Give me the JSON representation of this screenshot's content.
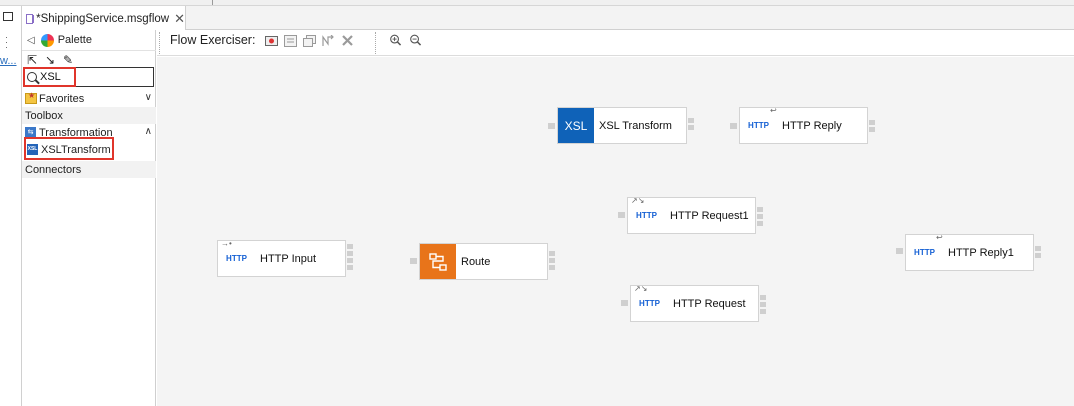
{
  "tab": {
    "title": "*ShippingService.msgflow",
    "close": "✕"
  },
  "gutter": {
    "link": "w..."
  },
  "palette": {
    "title": "Palette",
    "search_value": "XSL",
    "drawers": [
      {
        "label": "Favorites"
      },
      {
        "label": "Toolbox"
      },
      {
        "label": "Transformation"
      },
      {
        "label": "Connectors"
      }
    ],
    "items": [
      {
        "label": "XSLTransform",
        "icon_text": "XSL"
      }
    ]
  },
  "toolbar": {
    "flow_exerciser_label": "Flow Exerciser:"
  },
  "canvas": {
    "nodes": [
      {
        "label": "XSL Transform",
        "icon_text": "XSL"
      },
      {
        "label": "HTTP Reply",
        "icon_text": "HTTP"
      },
      {
        "label": "HTTP Request1",
        "icon_text": "HTTP"
      },
      {
        "label": "HTTP Input",
        "icon_text": "HTTP"
      },
      {
        "label": "Route"
      },
      {
        "label": "HTTP Reply1",
        "icon_text": "HTTP"
      },
      {
        "label": "HTTP Request",
        "icon_text": "HTTP"
      }
    ]
  },
  "colors": {
    "highlight": "#e0352b",
    "xsl_blue": "#0f62b8",
    "route_orange": "#e8741a",
    "http_text": "#1560d4",
    "canvas_bg": "#f4f4f4"
  }
}
